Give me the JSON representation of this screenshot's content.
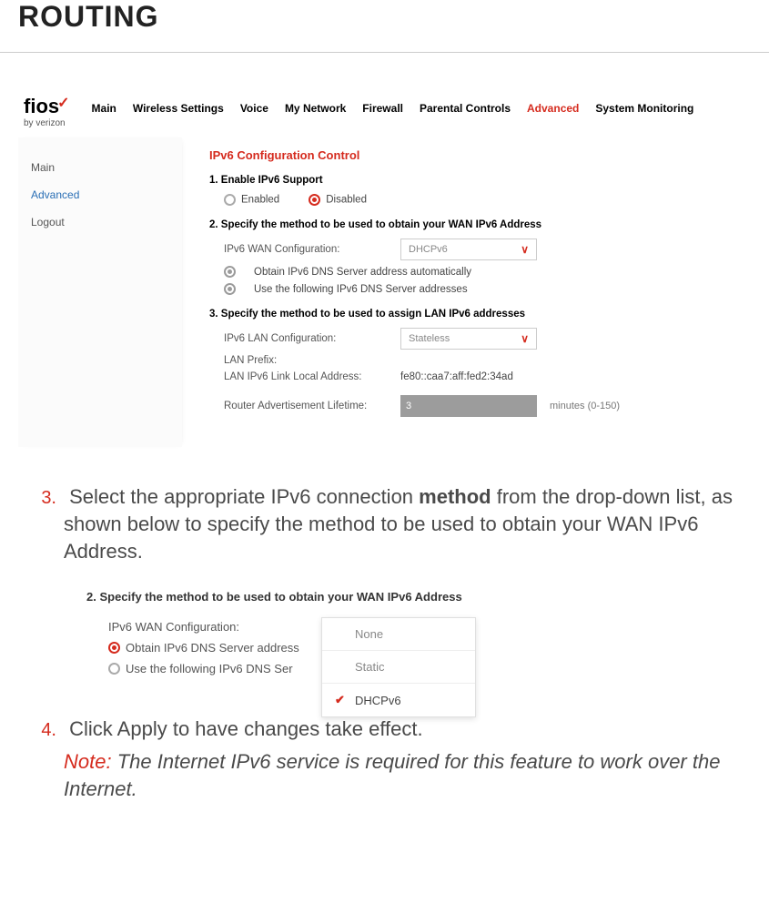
{
  "page_heading": "ROUTING",
  "logo": {
    "text": "fios",
    "subtext": "by verizon"
  },
  "nav": {
    "items": [
      "Main",
      "Wireless Settings",
      "Voice",
      "My Network",
      "Firewall",
      "Parental Controls",
      "Advanced",
      "System Monitoring"
    ],
    "active": "Advanced"
  },
  "sidebar": {
    "items": [
      "Main",
      "Advanced",
      "Logout"
    ],
    "selected": "Advanced"
  },
  "panel": {
    "title": "IPv6 Configuration Control",
    "step1_heading": "1. Enable IPv6 Support",
    "enabled_label": "Enabled",
    "disabled_label": "Disabled",
    "step2_heading": "2. Specify the method to be used to obtain your WAN IPv6 Address",
    "wan_label": "IPv6 WAN Configuration:",
    "wan_value": "DHCPv6",
    "dns_auto": "Obtain IPv6 DNS Server address automatically",
    "dns_manual": "Use the following IPv6 DNS Server addresses",
    "step3_heading": "3. Specify the method to be used to assign LAN IPv6 addresses",
    "lan_label": "IPv6 LAN Configuration:",
    "lan_value": "Stateless",
    "lan_prefix_label": "LAN Prefix:",
    "lan_link_label": "LAN IPv6 Link Local Address:",
    "lan_link_value": "fe80::caa7:aff:fed2:34ad",
    "ra_lifetime_label": "Router Advertisement Lifetime:",
    "ra_lifetime_value": "3",
    "ra_units": "minutes (0-150)"
  },
  "step3_text_a": "Select the appropriate IPv6 connection ",
  "step3_bold": "method",
  "step3_text_b": " from the drop-down list, as shown below to specify the method to be used to obtain your WAN IPv6 Address.",
  "step3_num": "3.",
  "shot2": {
    "heading": "2. Specify the method to be used to obtain your WAN IPv6 Address",
    "wan_label": "IPv6 WAN Configuration:",
    "dns_auto_short": "Obtain IPv6 DNS Server address",
    "dns_manual_short": "Use the following IPv6 DNS Ser",
    "options": [
      "None",
      "Static",
      "DHCPv6"
    ],
    "selected": "DHCPv6"
  },
  "step4_num": "4.",
  "step4_text": "Click Apply to have changes take effect.",
  "note_label": "Note:",
  "note_text": " The Internet IPv6 service is required for this feature to work over the Internet."
}
